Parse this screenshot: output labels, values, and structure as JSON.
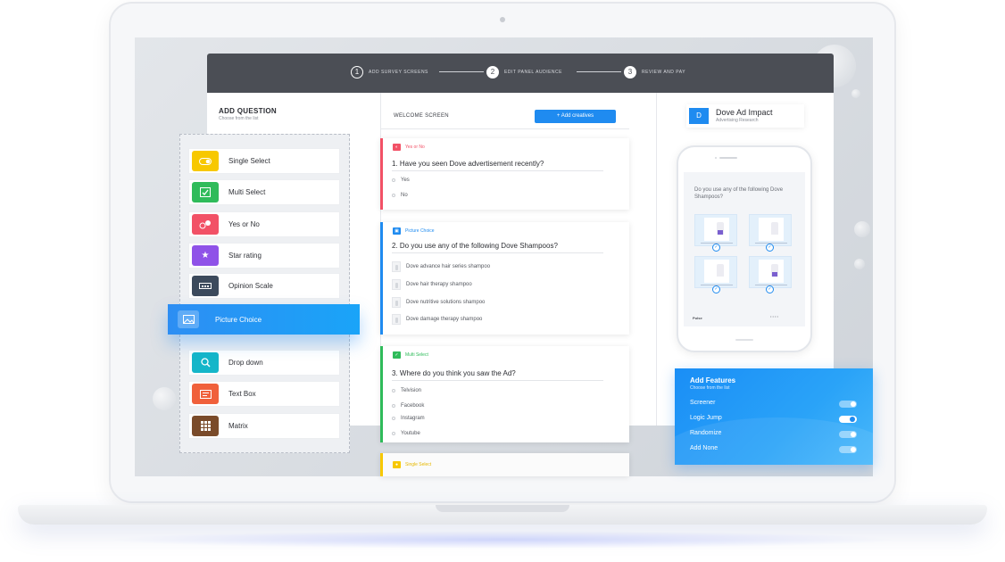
{
  "stepper": [
    {
      "num": "1",
      "label": "ADD SURVEY SCREENS"
    },
    {
      "num": "2",
      "label": "EDIT PANEL AUDIENCE"
    },
    {
      "num": "3",
      "label": "REVIEW AND PAY"
    }
  ],
  "add_question": {
    "title": "ADD QUESTION",
    "subtitle": "Choose from the list",
    "items": [
      {
        "label": "Single Select",
        "icon": "toggle-icon",
        "color": "#f7c800"
      },
      {
        "label": "Multi Select",
        "icon": "checkbox-icon",
        "color": "#2fbb5a"
      },
      {
        "label": "Yes or No",
        "icon": "yes-no-icon",
        "color": "#f25166"
      },
      {
        "label": "Star rating",
        "icon": "star-icon",
        "color": "#8f52e8"
      },
      {
        "label": "Opinion Scale",
        "icon": "scale-icon",
        "color": "#3c4a5c"
      },
      {
        "label": "Picture Choice",
        "icon": "picture-icon",
        "color": "#1f8bf0"
      },
      {
        "label": "Drop down",
        "icon": "search-icon",
        "color": "#15b6c9"
      },
      {
        "label": "Text Box",
        "icon": "text-box-icon",
        "color": "#f0603b"
      },
      {
        "label": "Matrix",
        "icon": "grid-icon",
        "color": "#7a4b2a"
      }
    ]
  },
  "editor": {
    "welcome_label": "WELCOME SCREEN",
    "add_button": "+ Add creatives",
    "cards": [
      {
        "type": "Yes or No",
        "color": "#f25166",
        "question": "1. Have you seen Dove advertisement recently?",
        "options": [
          "Yes",
          "No"
        ]
      },
      {
        "type": "Picture Choice",
        "color": "#1f8bf0",
        "question": "2. Do you use any of the following Dove Shampoos?",
        "options": [
          "Dove advance hair series shampoo",
          "Dove hair therapy shampoo",
          "Dove nutritive solutions shampoo",
          "Dove damage therapy shampoo"
        ]
      },
      {
        "type": "Multi Select",
        "color": "#2fbb5a",
        "question": "3. Where do you think you saw the Ad?",
        "options": [
          "Telvision",
          "Facebook",
          "Instagram",
          "Youtube"
        ]
      },
      {
        "type": "Single Select",
        "color": "#f7c800"
      }
    ]
  },
  "preview": {
    "badge": "D",
    "title": "Dove Ad Impact",
    "subtitle": "Advertising Research",
    "phone_question": "Do you use any of the following Dove Shampoos?",
    "phone_brand": "Pulse"
  },
  "features": {
    "title": "Add Features",
    "subtitle": "Choose from the list",
    "items": [
      {
        "label": "Screener",
        "on": false
      },
      {
        "label": "Logic Jump",
        "on": true
      },
      {
        "label": "Randomize",
        "on": false
      },
      {
        "label": "Add None",
        "on": false
      }
    ]
  }
}
